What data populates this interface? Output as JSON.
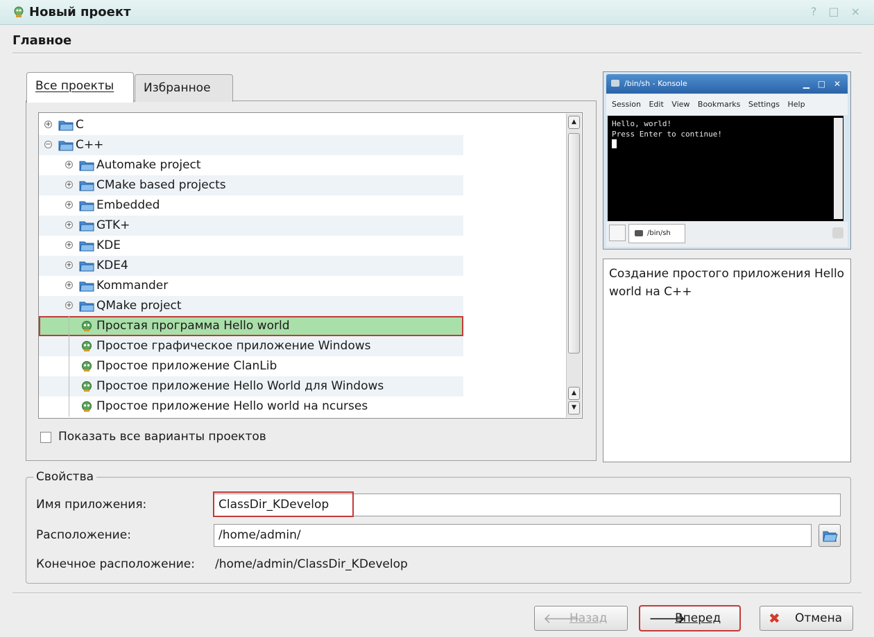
{
  "window": {
    "title": "Новый проект",
    "controls": "? □ ×"
  },
  "header": {
    "title": "Главное"
  },
  "tabs": [
    {
      "label": "Все проекты",
      "active": true
    },
    {
      "label": "Избранное",
      "active": false
    }
  ],
  "tree": {
    "items": [
      {
        "label": "C",
        "type": "folder",
        "level": 0,
        "expander": "+"
      },
      {
        "label": "C++",
        "type": "folder",
        "level": 0,
        "expander": "−"
      },
      {
        "label": "Automake project",
        "type": "folder",
        "level": 1,
        "expander": "+"
      },
      {
        "label": "CMake based projects",
        "type": "folder",
        "level": 1,
        "expander": "+"
      },
      {
        "label": "Embedded",
        "type": "folder",
        "level": 1,
        "expander": "+"
      },
      {
        "label": "GTK+",
        "type": "folder",
        "level": 1,
        "expander": "+"
      },
      {
        "label": "KDE",
        "type": "folder",
        "level": 1,
        "expander": "+"
      },
      {
        "label": "KDE4",
        "type": "folder",
        "level": 1,
        "expander": "+"
      },
      {
        "label": "Kommander",
        "type": "folder",
        "level": 1,
        "expander": "+"
      },
      {
        "label": "QMake project",
        "type": "folder",
        "level": 1,
        "expander": "+"
      },
      {
        "label": "Простая программа Hello world",
        "type": "template",
        "level": 1,
        "selected": true
      },
      {
        "label": "Простое графическое приложение Windows",
        "type": "template",
        "level": 1
      },
      {
        "label": "Простое приложение ClanLib",
        "type": "template",
        "level": 1
      },
      {
        "label": "Простое приложение Hello World для Windows",
        "type": "template",
        "level": 1
      },
      {
        "label": "Простое приложение Hello world на ncurses",
        "type": "template",
        "level": 1
      }
    ]
  },
  "show_all_checkbox": {
    "label": "Показать все варианты проектов",
    "checked": false
  },
  "preview": {
    "title": "/bin/sh - Konsole",
    "menu": [
      "Session",
      "Edit",
      "View",
      "Bookmarks",
      "Settings",
      "Help"
    ],
    "terminal_lines": [
      "Hello, world!",
      "Press Enter to continue!"
    ],
    "tab_label": "/bin/sh"
  },
  "description": "Создание простого приложения Hello world на C++",
  "properties": {
    "legend": "Свойства",
    "app_name_label": "Имя приложения:",
    "app_name_value": "ClassDir_KDevelop",
    "location_label": "Расположение:",
    "location_value": "/home/admin/",
    "final_location_label": "Конечное расположение:",
    "final_location_value": "/home/admin/ClassDir_KDevelop"
  },
  "buttons": {
    "back": "Назад",
    "next": "Вперед",
    "cancel": "Отмена"
  },
  "colors": {
    "selection": "#a9dfa9",
    "highlight_border": "#c33a3a",
    "folder": "#4a8fd8",
    "template": "#5aa55a"
  }
}
